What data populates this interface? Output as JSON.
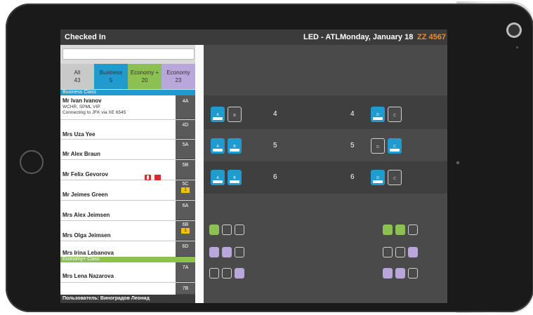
{
  "topbar": {
    "title": "Checked In",
    "route": "LED - ATL",
    "date": "Monday, January 18",
    "flight": "ZZ 4567"
  },
  "filters": [
    {
      "label": "All",
      "count": "43",
      "color": "#c9c9c9"
    },
    {
      "label": "Business",
      "count": "5",
      "color": "#1f9bd0"
    },
    {
      "label": "Economy +",
      "count": "20",
      "color": "#8cc152"
    },
    {
      "label": "Economy",
      "count": "23",
      "color": "#b9a6da"
    }
  ],
  "sections": {
    "business": "Business Class",
    "economy_plus": "Economy+ Class"
  },
  "passengers": [
    {
      "name": "Mr Ivan Ivanov",
      "detail1": "WCHR, SPML VIP",
      "detail2": "Connecting to JFK via XE 6545",
      "seat": "4A"
    },
    {
      "name": "Mrs Uza Yee",
      "seat": "4D"
    },
    {
      "name": "Mr Alex Braun",
      "seat": "5A"
    },
    {
      "name": "Mr Felix Gevorov",
      "seat": "5B"
    },
    {
      "name": "Mr Jeimes Green",
      "seat": "5C",
      "badge": "1"
    },
    {
      "name": "Mrs Alex Jeimsen",
      "seat": "6A"
    },
    {
      "name": "Mrs Olga Jeimsen",
      "seat": "6B",
      "badge": "1"
    },
    {
      "name": "Mrs Irina Lebanova",
      "seat": "6D"
    },
    {
      "name": "Mrs Lena Nazarova",
      "seat": "7A"
    },
    {
      "name": "",
      "seat": "7B"
    }
  ],
  "footer": {
    "user": "Пользователь: Виноградов Леонид"
  },
  "seatmap": {
    "row_numbers": [
      "4",
      "5",
      "6"
    ],
    "colors": {
      "business": "#1f9bd0",
      "econ_plus": "#8cc152",
      "economy": "#b9a6da"
    }
  }
}
